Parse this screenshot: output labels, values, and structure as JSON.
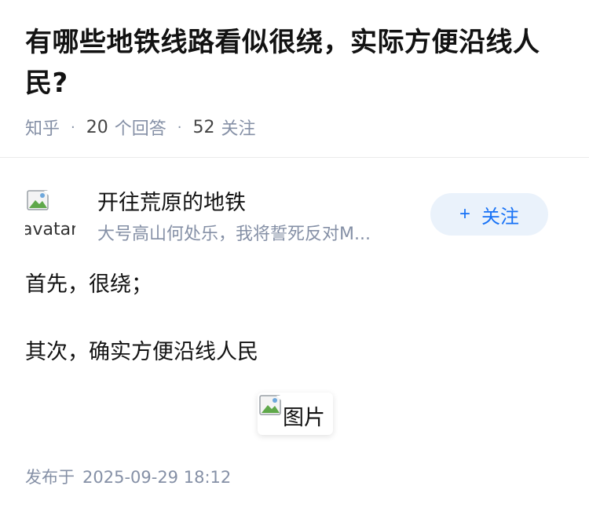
{
  "question": {
    "title": "有哪些地铁线路看似很绕，实际方便沿线人民?",
    "source": "知乎",
    "answer_count": "20",
    "answer_label": "个回答",
    "follow_count": "52",
    "follow_label": "关注"
  },
  "author": {
    "avatar_alt": "avatar",
    "name": "开往荒原的地铁",
    "bio": "大号高山何处乐，我将誓死反对M...",
    "follow_button": "关注",
    "follow_icon": "plus-icon"
  },
  "answer": {
    "paragraphs": [
      "首先，很绕；",
      "其次，确实方便沿线人民"
    ],
    "image_alt": "图片"
  },
  "footer": {
    "published_label": "发布于",
    "published_time": "2025-09-29 18:12"
  },
  "colors": {
    "meta": "#8590a6",
    "accent": "#1772f6",
    "follow_bg": "#eaf2fb"
  }
}
